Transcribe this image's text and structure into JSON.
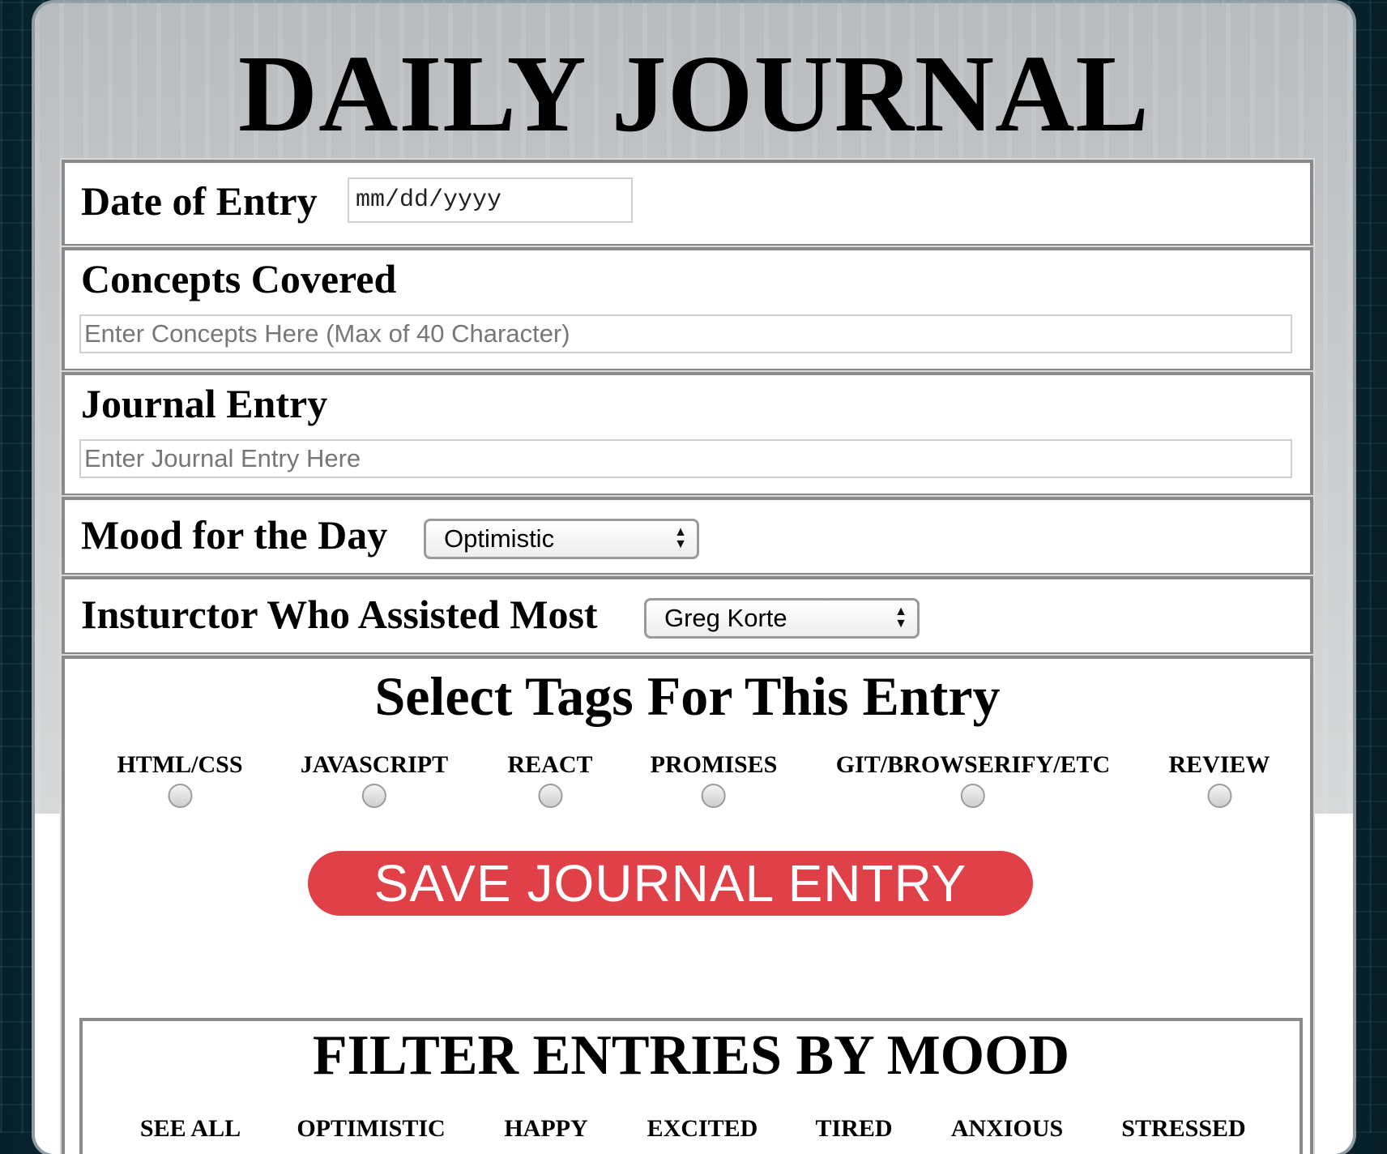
{
  "header": {
    "title": "DAILY JOURNAL"
  },
  "date": {
    "label": "Date of Entry",
    "placeholder": "mm/dd/yyyy"
  },
  "concepts": {
    "label": "Concepts Covered",
    "placeholder": "Enter Concepts Here (Max of 40 Character)"
  },
  "journal": {
    "label": "Journal Entry",
    "placeholder": "Enter Journal Entry Here"
  },
  "mood": {
    "label": "Mood for the Day",
    "selected": "Optimistic"
  },
  "instructor": {
    "label": "Insturctor Who Assisted Most",
    "selected": "Greg Korte"
  },
  "tags": {
    "title": "Select Tags For This Entry",
    "items": [
      {
        "label": "HTML/CSS"
      },
      {
        "label": "JAVASCRIPT"
      },
      {
        "label": "REACT"
      },
      {
        "label": "PROMISES"
      },
      {
        "label": "GIT/BROWSERIFY/ETC"
      },
      {
        "label": "REVIEW"
      }
    ]
  },
  "save_button": {
    "label": "SAVE JOURNAL ENTRY",
    "color": "#e04149"
  },
  "filter": {
    "title": "FILTER ENTRIES BY MOOD",
    "options": [
      {
        "label": "SEE ALL"
      },
      {
        "label": "OPTIMISTIC"
      },
      {
        "label": "HAPPY"
      },
      {
        "label": "EXCITED"
      },
      {
        "label": "TIRED"
      },
      {
        "label": "ANXIOUS"
      },
      {
        "label": "STRESSED"
      }
    ]
  }
}
